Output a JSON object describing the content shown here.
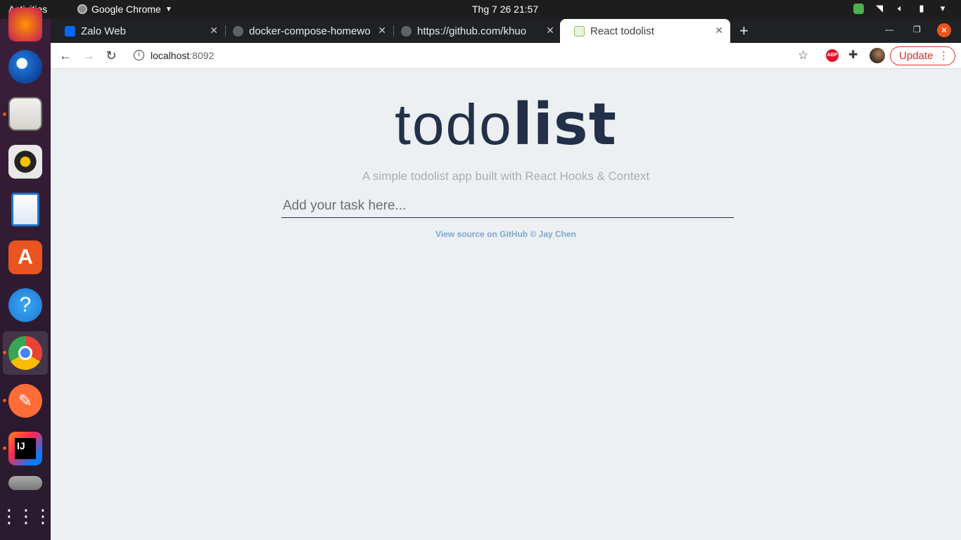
{
  "topbar": {
    "activities": "Activities",
    "app_name": "Google Chrome",
    "clock": "Thg 7 26  21:57"
  },
  "dock": {
    "items": [
      "firefox-icon",
      "thunderbird-icon",
      "files-icon",
      "rhythmbox-icon",
      "libreoffice-writer-icon",
      "ubuntu-software-icon",
      "help-icon",
      "chrome-icon",
      "postman-icon",
      "intellij-icon",
      "drive-icon",
      "show-applications-icon"
    ]
  },
  "tabs": [
    {
      "title": "Zalo Web",
      "icon_color": "#0068ff"
    },
    {
      "title": "docker-compose-homewo",
      "icon_color": "#5f6368"
    },
    {
      "title": "https://github.com/khuo",
      "icon_color": "#5f6368"
    },
    {
      "title": "React todolist",
      "icon_color": "#8bc34a"
    }
  ],
  "toolbar": {
    "url_host": "localhost",
    "url_port": ":8092",
    "abp_label": "ABP",
    "update_label": "Update"
  },
  "page": {
    "logo_light": "todo",
    "logo_bold": "list",
    "subtitle": "A simple todolist app built with React Hooks & Context",
    "input_placeholder": "Add your task here...",
    "footer": "View source on GitHub © Jay Chen"
  },
  "colors": {
    "accent": "#233049",
    "update_red": "#d93025",
    "ubuntu_orange": "#e95420"
  }
}
